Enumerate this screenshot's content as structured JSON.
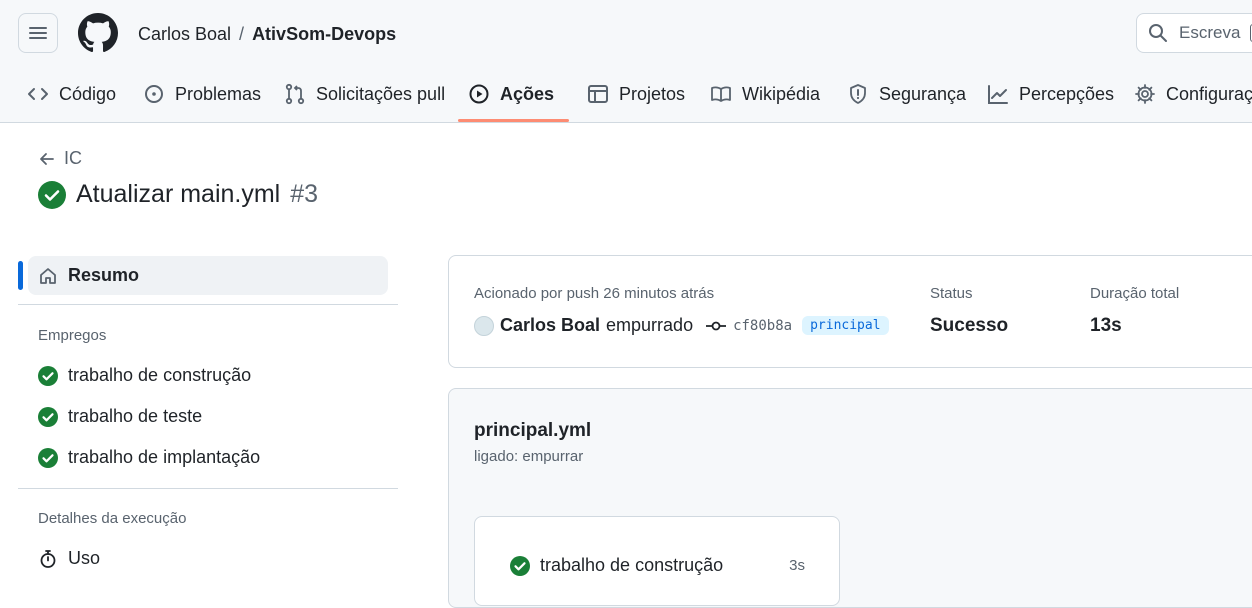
{
  "header": {
    "owner": "Carlos Boal",
    "separator": "/",
    "repo": "AtivSom-Devops",
    "search_placeholder": "Escreva",
    "search_shortcut": "/"
  },
  "tabs": [
    {
      "label": "Código",
      "icon": "code-icon"
    },
    {
      "label": "Problemas",
      "icon": "issue-icon"
    },
    {
      "label": "Solicitações pull",
      "icon": "pull-request-icon"
    },
    {
      "label": "Ações",
      "icon": "play-icon",
      "active": true
    },
    {
      "label": "Projetos",
      "icon": "table-icon"
    },
    {
      "label": "Wikipédia",
      "icon": "book-icon"
    },
    {
      "label": "Segurança",
      "icon": "shield-icon"
    },
    {
      "label": "Percepções",
      "icon": "graph-icon"
    },
    {
      "label": "Configuraç",
      "icon": "gear-icon"
    }
  ],
  "run": {
    "back_label": "IC",
    "title": "Atualizar main.yml",
    "number": "#3"
  },
  "sidebar": {
    "summary_label": "Resumo",
    "jobs_heading": "Empregos",
    "jobs": [
      {
        "label": "trabalho de construção"
      },
      {
        "label": "trabalho de teste"
      },
      {
        "label": "trabalho de implantação"
      }
    ],
    "details_heading": "Detalhes da execução",
    "usage_label": "Uso"
  },
  "summary": {
    "triggered_label": "Acionado por push 26 minutos atrás",
    "actor": "Carlos Boal",
    "action": "empurrado",
    "commit": "cf80b8a",
    "branch": "principal",
    "status_label": "Status",
    "status_value": "Sucesso",
    "duration_label": "Duração total",
    "duration_value": "13s"
  },
  "workflow": {
    "file": "principal.yml",
    "trigger": "ligado: empurrar",
    "job_name": "trabalho de construção",
    "job_duration": "3s"
  },
  "colors": {
    "success": "#1a7f37",
    "accent_underline": "#fd8c73",
    "link_blue": "#0969da"
  }
}
